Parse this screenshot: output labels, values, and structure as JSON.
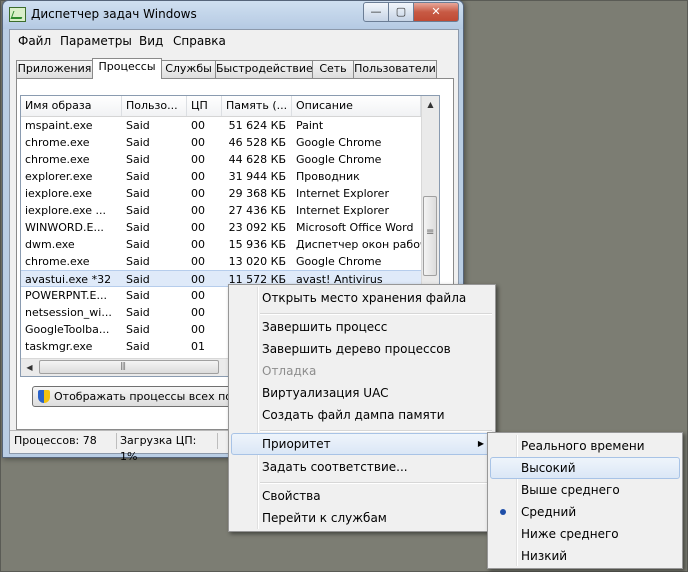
{
  "window": {
    "title": "Диспетчер задач Windows",
    "buttons": {
      "minimize": "—",
      "maximize": "▢",
      "close": "✕"
    }
  },
  "menubar": [
    "Файл",
    "Параметры",
    "Вид",
    "Справка"
  ],
  "tabs": [
    "Приложения",
    "Процессы",
    "Службы",
    "Быстродействие",
    "Сеть",
    "Пользователи"
  ],
  "active_tab": "Процессы",
  "columns": [
    "Имя образа",
    "Пользо...",
    "ЦП",
    "Память (...",
    "Описание"
  ],
  "rows": [
    {
      "name": "mspaint.exe",
      "user": "Said",
      "cpu": "00",
      "mem": "51 624 КБ",
      "desc": "Paint"
    },
    {
      "name": "chrome.exe",
      "user": "Said",
      "cpu": "00",
      "mem": "46 528 КБ",
      "desc": "Google Chrome"
    },
    {
      "name": "chrome.exe",
      "user": "Said",
      "cpu": "00",
      "mem": "44 628 КБ",
      "desc": "Google Chrome"
    },
    {
      "name": "explorer.exe",
      "user": "Said",
      "cpu": "00",
      "mem": "31 944 КБ",
      "desc": "Проводник"
    },
    {
      "name": "iexplore.exe",
      "user": "Said",
      "cpu": "00",
      "mem": "29 368 КБ",
      "desc": "Internet Explorer"
    },
    {
      "name": "iexplore.exe ...",
      "user": "Said",
      "cpu": "00",
      "mem": "27 436 КБ",
      "desc": "Internet Explorer"
    },
    {
      "name": "WINWORD.E...",
      "user": "Said",
      "cpu": "00",
      "mem": "23 092 КБ",
      "desc": "Microsoft Office Word"
    },
    {
      "name": "dwm.exe",
      "user": "Said",
      "cpu": "00",
      "mem": "15 936 КБ",
      "desc": "Диспетчер окон рабочег"
    },
    {
      "name": "chrome.exe",
      "user": "Said",
      "cpu": "00",
      "mem": "13 020 КБ",
      "desc": "Google Chrome"
    },
    {
      "name": "avastui.exe *32",
      "user": "Said",
      "cpu": "00",
      "mem": "11 572 КБ",
      "desc": "avast! Antivirus"
    },
    {
      "name": "POWERPNT.E...",
      "user": "Said",
      "cpu": "00",
      "mem": "",
      "desc": ""
    },
    {
      "name": "netsession_wi...",
      "user": "Said",
      "cpu": "00",
      "mem": "",
      "desc": ""
    },
    {
      "name": "GoogleToolba...",
      "user": "Said",
      "cpu": "00",
      "mem": "",
      "desc": ""
    },
    {
      "name": "taskmgr.exe",
      "user": "Said",
      "cpu": "01",
      "mem": "",
      "desc": ""
    }
  ],
  "selected_row": 9,
  "show_all_button": "Отображать процессы всех польз",
  "status": {
    "processes": "Процессов: 78",
    "cpu": "Загрузка ЦП: 1%"
  },
  "context_menu": {
    "open_location": "Открыть место хранения файла",
    "end_process": "Завершить процесс",
    "end_tree": "Завершить дерево процессов",
    "debug": "Отладка",
    "uac": "Виртуализация UAC",
    "dump": "Создать файл дампа памяти",
    "priority": "Приоритет",
    "affinity": "Задать соответствие...",
    "properties": "Свойства",
    "goto_services": "Перейти к службам"
  },
  "priority_menu": {
    "realtime": "Реального времени",
    "high": "Высокий",
    "above_normal": "Выше среднего",
    "normal": "Средний",
    "below_normal": "Ниже среднего",
    "low": "Низкий"
  },
  "priority_selected": "Средний",
  "priority_highlighted": "Высокий"
}
